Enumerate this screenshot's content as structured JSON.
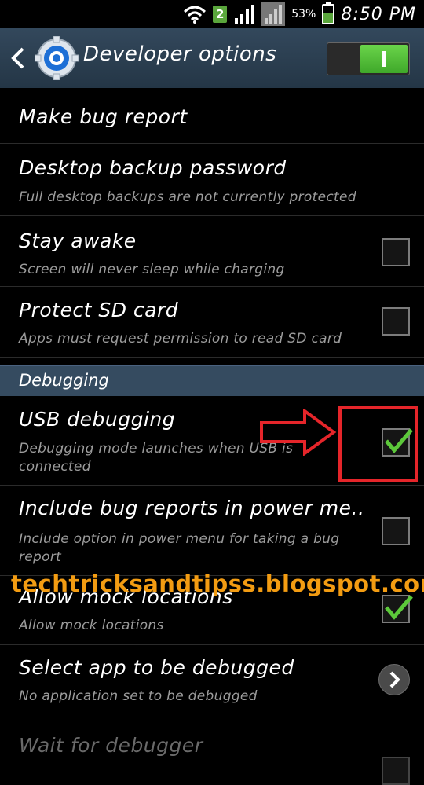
{
  "status_bar": {
    "sim_badge": "2",
    "battery_percent": "53%",
    "battery_level": 0.53,
    "time": "8:50 PM",
    "icons": [
      "wifi-icon",
      "signal-icon",
      "signal-no-service-icon",
      "battery-icon"
    ]
  },
  "action_bar": {
    "title": "Developer options",
    "master_switch_on": true,
    "icons": [
      "back-chevron-icon",
      "gear-icon"
    ]
  },
  "items": [
    {
      "label": "Make bug report"
    },
    {
      "label": "Desktop backup password",
      "summary": "Full desktop backups are not currently protected"
    },
    {
      "label": "Stay awake",
      "summary": "Screen will never sleep while charging",
      "checked": false
    },
    {
      "label": "Protect SD card",
      "summary": "Apps must request permission to read SD card",
      "checked": false
    }
  ],
  "section": {
    "header": "Debugging"
  },
  "debug_items": [
    {
      "label": "USB debugging",
      "summary_line1": "Debugging mode launches when USB is",
      "summary_line2": "connected",
      "checked": true
    },
    {
      "label": "Include bug reports in power me..",
      "summary_line1": "Include option in power menu for taking a bug",
      "summary_line2": "report",
      "checked": false
    },
    {
      "label": "Allow mock locations",
      "summary": "Allow mock locations",
      "checked": true
    },
    {
      "label": "Select app to be debugged",
      "summary": "No application set to be debugged"
    },
    {
      "label": "Wait for debugger",
      "disabled": true
    }
  ],
  "watermark": "techtricksandtipss.blogspot.com",
  "colors": {
    "accent_green": "#5aa63c",
    "highlight_red": "#e5252a",
    "watermark_orange": "#f39c12",
    "actionbar": "#2c3f52"
  }
}
